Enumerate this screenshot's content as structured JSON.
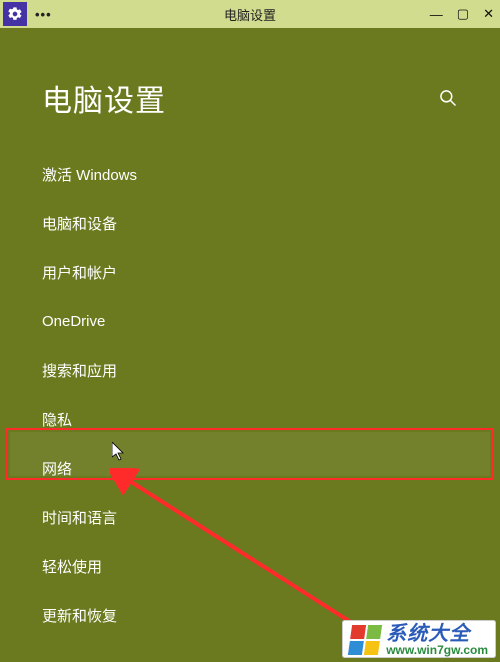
{
  "titlebar": {
    "menu_dots": "•••",
    "title": "电脑设置",
    "minimize": "—",
    "maximize": "▢",
    "close": "✕"
  },
  "header": {
    "heading": "电脑设置"
  },
  "nav": {
    "items": [
      {
        "label": "激活 Windows",
        "selected": false
      },
      {
        "label": "电脑和设备",
        "selected": false
      },
      {
        "label": "用户和帐户",
        "selected": false
      },
      {
        "label": "OneDrive",
        "selected": false
      },
      {
        "label": "搜索和应用",
        "selected": false
      },
      {
        "label": "隐私",
        "selected": true
      },
      {
        "label": "网络",
        "selected": false
      },
      {
        "label": "时间和语言",
        "selected": false
      },
      {
        "label": "轻松使用",
        "selected": false
      },
      {
        "label": "更新和恢复",
        "selected": false
      }
    ]
  },
  "watermark": {
    "line1": "系统大全",
    "line2": "www.win7gw.com"
  }
}
